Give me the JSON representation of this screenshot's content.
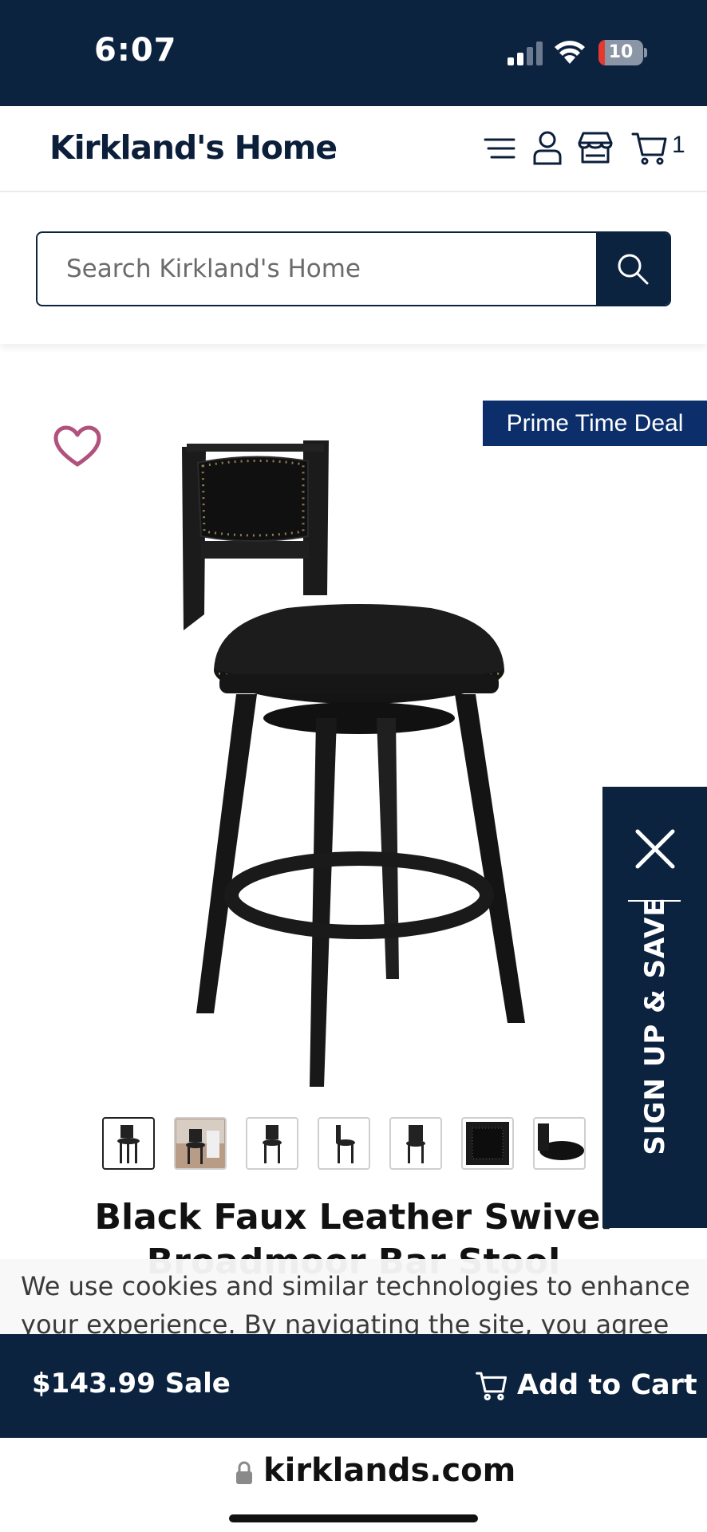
{
  "status_bar": {
    "time": "6:07",
    "battery": "10"
  },
  "header": {
    "logo": "Kirkland's Home",
    "cart_count": "1"
  },
  "search": {
    "placeholder": "Search Kirkland's Home"
  },
  "product": {
    "badge": "Prime Time Deal",
    "title_line1": "Black Faux Leather Swivel",
    "title_line2": "Broadmoor Bar Stool",
    "thumbnail_count": 7
  },
  "signup_tab": {
    "label": "SIGN UP & SAVE"
  },
  "cookie_banner": {
    "text": "We use cookies and similar technologies to enhance your experience. By navigating the site, you agree to"
  },
  "sticky_bar": {
    "price": "$143.99 Sale",
    "add_to_cart": "Add to Cart"
  },
  "url_bar": {
    "domain": "kirklands.com"
  },
  "icons": {
    "menu": "menu-icon",
    "account": "user-icon",
    "store": "store-icon",
    "cart": "cart-icon",
    "search": "search-icon",
    "wishlist": "heart-icon",
    "close": "close-icon",
    "lock": "lock-icon"
  },
  "colors": {
    "navy": "#0c2340",
    "badge_blue": "#0c2f6b",
    "heart": "#b0527d",
    "battery_low": "#e5392f"
  }
}
